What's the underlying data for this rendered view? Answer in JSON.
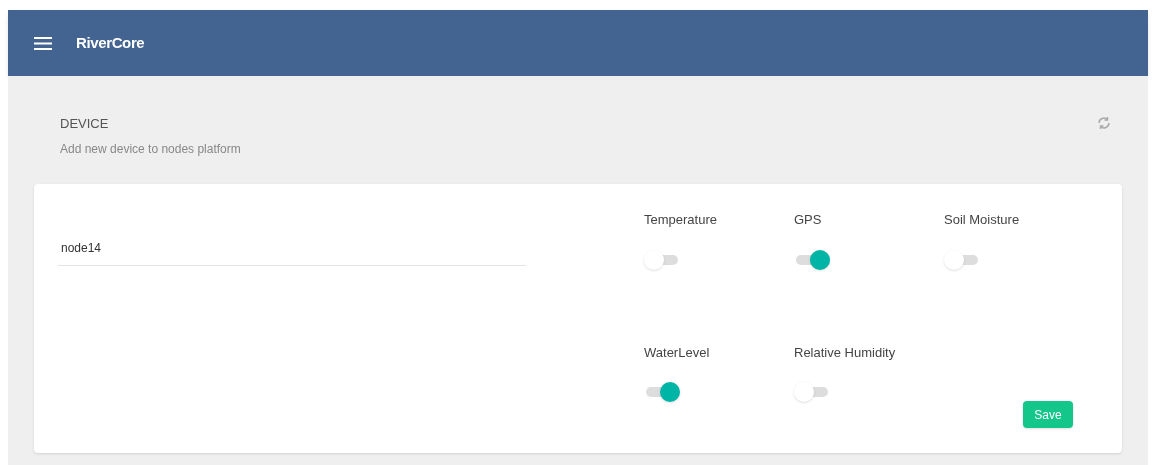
{
  "app_bar": {
    "title": "RiverCore"
  },
  "section": {
    "title": "DEVICE",
    "subtitle": "Add new device to nodes platform"
  },
  "device_name": {
    "value": "node14"
  },
  "sensors": [
    {
      "label": "Temperature",
      "on": false
    },
    {
      "label": "GPS",
      "on": true
    },
    {
      "label": "Soil Moisture",
      "on": false
    },
    {
      "label": "WaterLevel",
      "on": true
    },
    {
      "label": "Relative Humidity",
      "on": false
    }
  ],
  "buttons": [
    {
      "label": "Save"
    }
  ]
}
